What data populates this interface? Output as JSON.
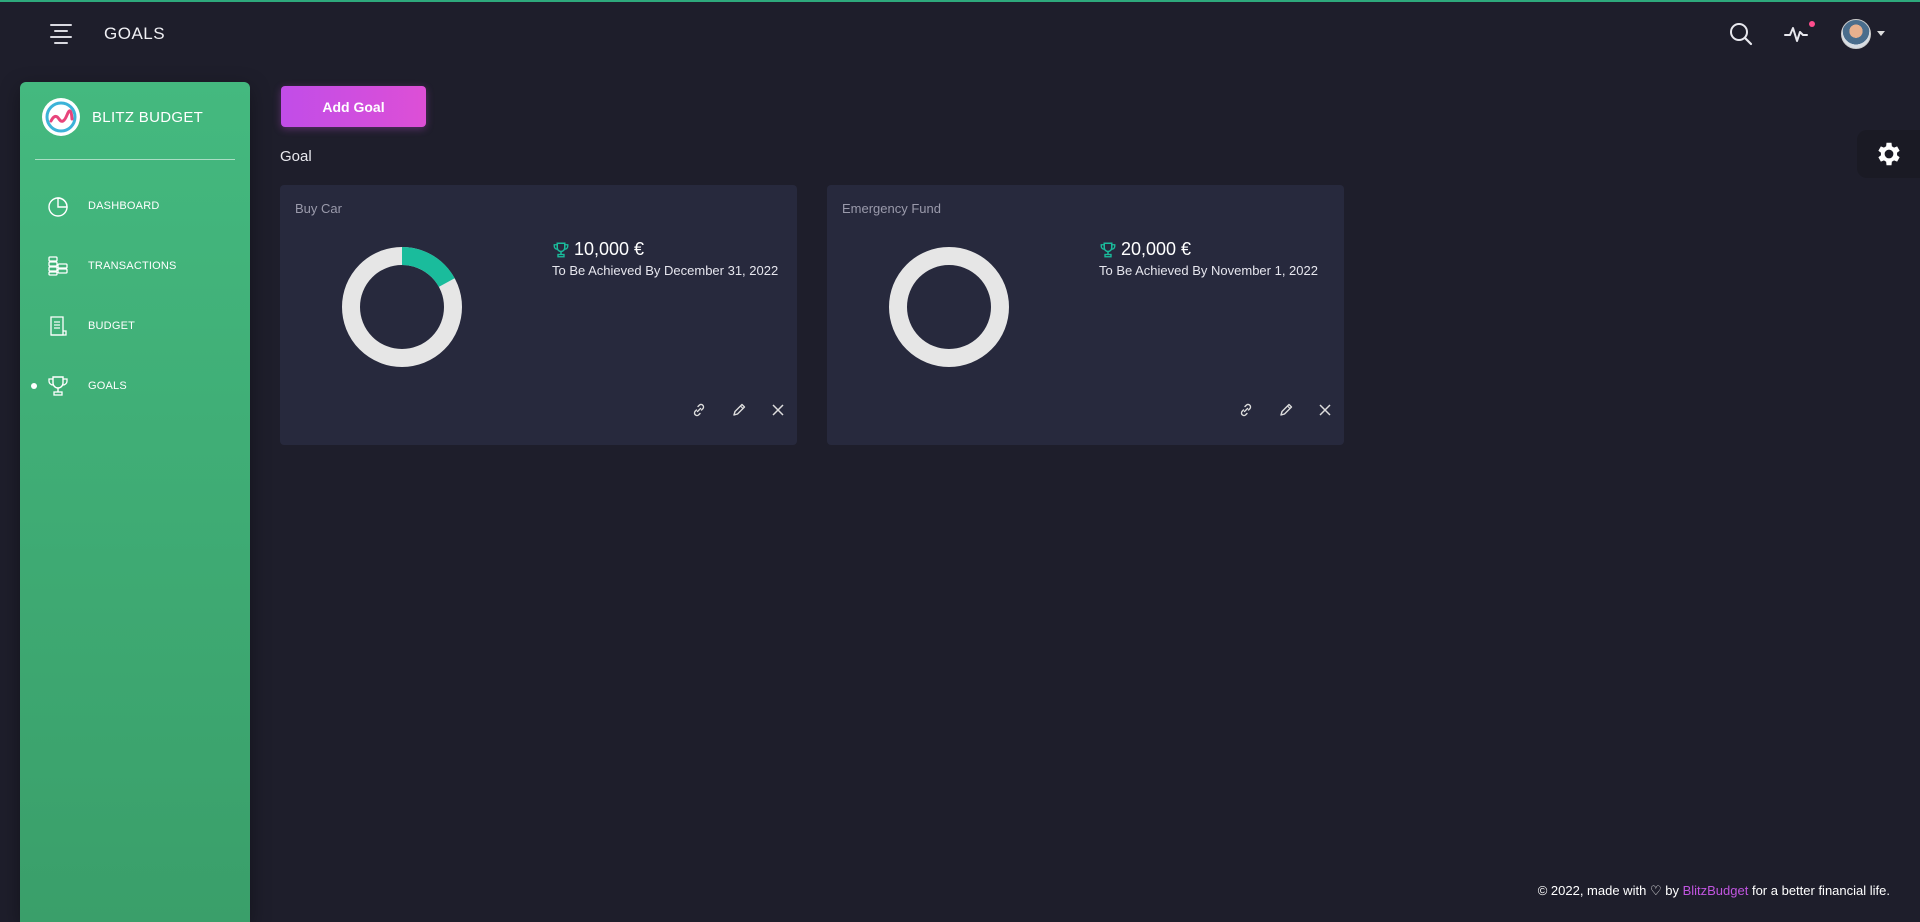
{
  "header": {
    "title": "GOALS",
    "icons": [
      "menu-icon",
      "search-icon",
      "activity-icon",
      "avatar"
    ]
  },
  "sidebar": {
    "brand": "BLITZ BUDGET",
    "items": [
      {
        "label": "DASHBOARD",
        "icon": "pie-chart-icon",
        "active": false
      },
      {
        "label": "TRANSACTIONS",
        "icon": "coins-icon",
        "active": false
      },
      {
        "label": "BUDGET",
        "icon": "receipt-icon",
        "active": false
      },
      {
        "label": "GOALS",
        "icon": "trophy-icon",
        "active": true
      }
    ]
  },
  "main": {
    "add_button": "Add Goal",
    "section_title": "Goal",
    "goals": [
      {
        "title": "Buy Car",
        "amount": "10,000 €",
        "target": "To Be Achieved By December 31, 2022",
        "progress": 0.17
      },
      {
        "title": "Emergency Fund",
        "amount": "20,000 €",
        "target": "To Be Achieved By November 1, 2022",
        "progress": 0.0
      }
    ]
  },
  "footer": {
    "prefix": "© 2022, made with",
    "by": "by",
    "brand_link": "BlitzBudget",
    "suffix": "for a better financial life."
  },
  "colors": {
    "accent_green": "#44b97f",
    "progress_teal": "#1abc9c",
    "button_purple": "#c14de8",
    "background": "#1e1e2b",
    "card": "#27293d",
    "notification": "#ff4d8d"
  }
}
